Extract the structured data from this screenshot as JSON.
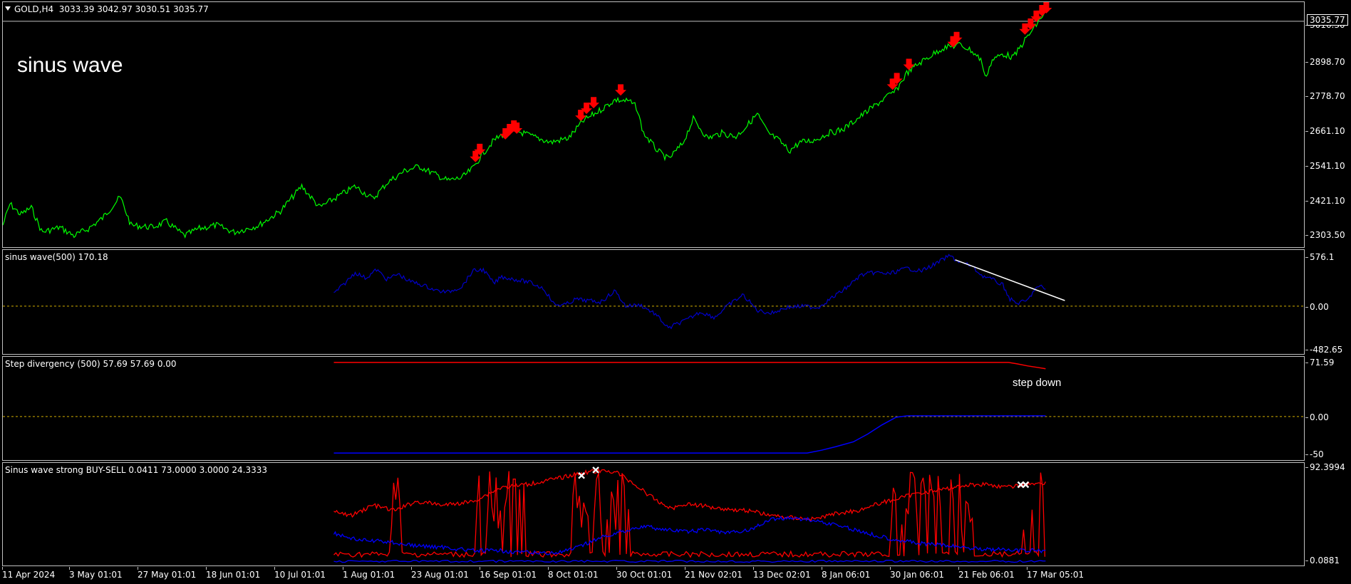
{
  "window": {
    "symbol_label": "GOLD,H4  3033.39 3042.97 3030.51 3035.77",
    "current_price": "3035.77"
  },
  "main_pane": {
    "title_text": "sinus wave",
    "y_ticks": [
      "3016.30",
      "2898.70",
      "2778.70",
      "2661.10",
      "2541.10",
      "2421.10",
      "2303.50"
    ],
    "line_color": "#00ff00",
    "arrow_color": "#ff0000",
    "arrow_icon": "red-down-arrow-icon"
  },
  "indicator1": {
    "label": "sinus wave(500) 170.18",
    "y_ticks": [
      "576.1",
      "0.00",
      "-482.65"
    ],
    "line_color": "#0000cc"
  },
  "indicator2": {
    "label": "Step divergency (500) 57.69 57.69 0.00",
    "y_ticks": [
      "71.59",
      "0.00",
      "-50"
    ],
    "annotation": "step down"
  },
  "indicator3": {
    "label": "Sinus wave strong BUY-SELL 0.0411 73.0000 3.0000 24.3333",
    "y_ticks": [
      "92.3994",
      "0.0881"
    ],
    "cross_icon": "white-x-marker-icon"
  },
  "x_axis": {
    "labels": [
      "11 Apr 2024",
      "3 May 01:01",
      "27 May 01:01",
      "18 Jun 01:01",
      "10 Jul 01:01",
      "1 Aug 01:01",
      "23 Aug 01:01",
      "16 Sep 01:01",
      "8 Oct 01:01",
      "30 Oct 01:01",
      "21 Nov 02:01",
      "13 Dec 02:01",
      "8 Jan 06:01",
      "30 Jan 06:01",
      "21 Feb 06:01",
      "17 Mar 05:01"
    ]
  }
}
